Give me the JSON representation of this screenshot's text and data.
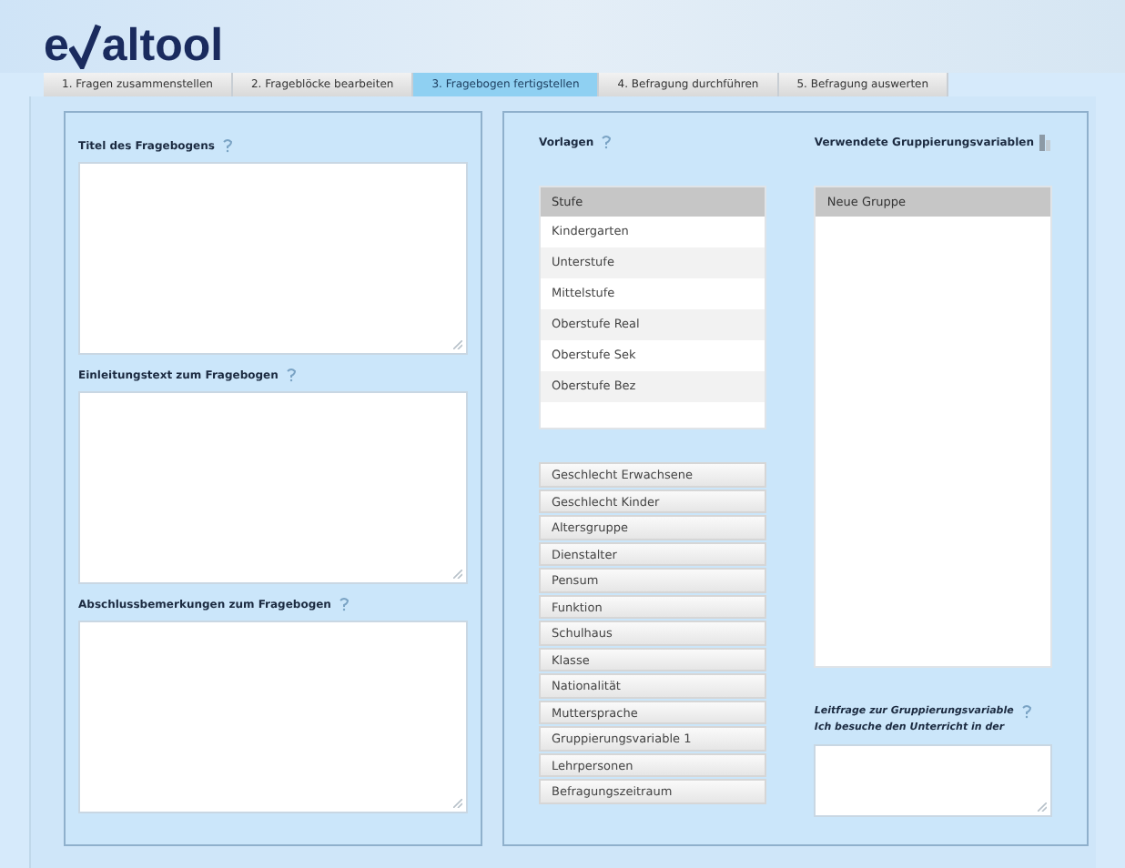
{
  "logo": {
    "before": "e",
    "after": "altool"
  },
  "tabs": [
    {
      "label": "1. Fragen zusammenstellen",
      "selected": false
    },
    {
      "label": "2. Frageblöcke bearbeiten",
      "selected": false
    },
    {
      "label": "3. Fragebogen fertigstellen",
      "selected": true
    },
    {
      "label": "4. Befragung durchführen",
      "selected": false
    },
    {
      "label": "5. Befragung auswerten",
      "selected": false
    }
  ],
  "fields": [
    {
      "label": "Titel des Fragebogens"
    },
    {
      "label": "Einleitungstext zum Fragebogen"
    },
    {
      "label": "Abschlussbemerkungen zum Fragebogen"
    }
  ],
  "vorlagen": {
    "label": "Vorlagen",
    "list": {
      "header": "Stufe",
      "items": [
        "Kindergarten",
        "Unterstufe",
        "Mittelstufe",
        "Oberstufe Real",
        "Oberstufe Sek",
        "Oberstufe Bez"
      ]
    },
    "groups": [
      "Geschlecht Erwachsene",
      "Geschlecht Kinder",
      "Altersgruppe",
      "Dienstalter",
      "Pensum",
      "Funktion",
      "Schulhaus",
      "Klasse",
      "Nationalität",
      "Muttersprache",
      "Gruppierungsvariable 1",
      "Lehrpersonen",
      "Befragungszeitraum"
    ]
  },
  "gruppierung": {
    "label": "Verwendete Gruppierungsvariablen",
    "list": {
      "header": "Neue Gruppe"
    }
  },
  "leitfrage": {
    "label": "Leitfrage zur Gruppierungsvariable",
    "subtitle": "Ich besuche den Unterricht in der"
  }
}
